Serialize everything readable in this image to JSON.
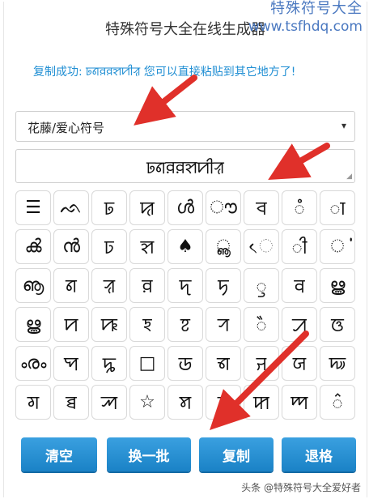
{
  "header": {
    "title": "特殊符号大全在线生成器",
    "watermark_line1": "特殊符号大全",
    "watermark_line2": "www.tsfhdq.com"
  },
  "status": {
    "message": "复制成功: ꠓꠘꠅꠅꠡꠙꠤꠟ 您可以直接粘贴到其它地方了!"
  },
  "category_select": {
    "selected": "花藤/爱心符号",
    "caret": "▾"
  },
  "output": {
    "value": "ꠓꠘꠅꠅꠡꠙꠤꠟ"
  },
  "symbols": [
    "☰",
    "ᨒ",
    "ꠓ",
    "ꠢ",
    "ൾ",
    "ൗ",
    "ꠌ",
    "ꠋ",
    "ꠣ",
    "ൿ",
    "ൻ",
    "ꠑ",
    "ꠡ",
    "♠",
    "ൣ",
    "ᨙ",
    "ꠤ",
    "ൎ",
    "ൡ",
    "ꠘ",
    "ꠟ",
    "ꠅ",
    "ꠖ",
    "ꠠ",
    "ꠥ",
    "ꠛ",
    "ൠ",
    "ൠ",
    "ꠙ",
    "ꠚ",
    "ꠁ",
    "ꠐ",
    "ꠞ",
    "ꠂ",
    "ꠀ",
    "ꠃ",
    "ൟ",
    "ꠗ",
    "ꠍ",
    "□",
    "ꠒ",
    "ꠜ",
    "ꠔ",
    "ꠎ",
    "ꠏ",
    "ꠉ",
    "ꠊ",
    "ꠕ",
    "☆",
    "ꠝ",
    "ꠞ",
    "ꠇ",
    "ꠈ",
    "꠆"
  ],
  "buttons": {
    "clear": "清空",
    "next_batch": "换一批",
    "copy": "复制",
    "back": "退格"
  },
  "footer": {
    "credit": "头条 @特殊符号大全爱好者"
  },
  "colors": {
    "status_text": "#1f8ed3",
    "button_blue": "#1a82c6",
    "watermark": "#4a78c0",
    "annotation_arrow": "#e0302a"
  }
}
